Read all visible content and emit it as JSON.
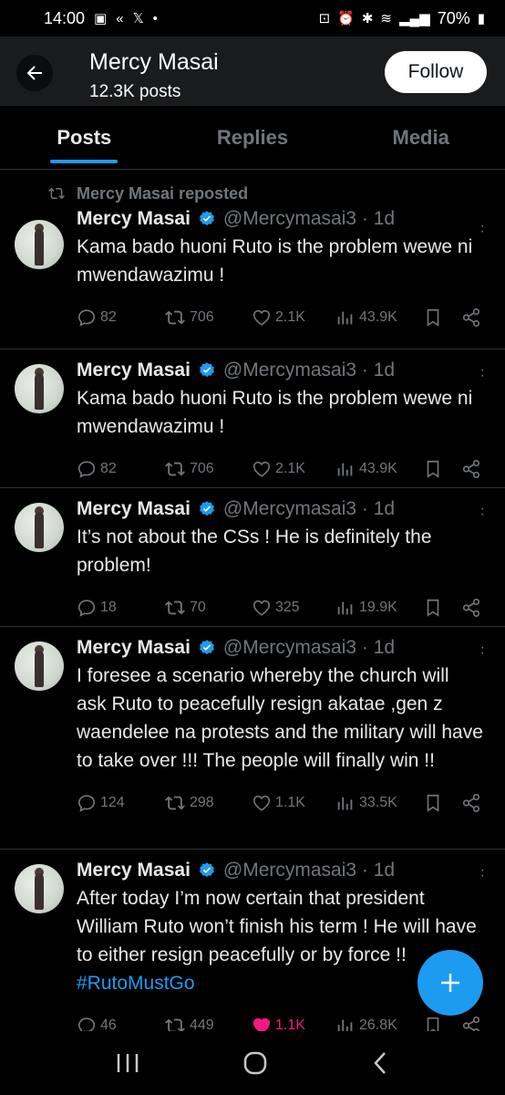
{
  "status_bar": {
    "time": "14:00",
    "battery": "70%"
  },
  "header": {
    "name": "Mercy Masai",
    "posts_count": "12.3K posts",
    "follow_label": "Follow"
  },
  "tabs": [
    {
      "label": "Posts",
      "active": true
    },
    {
      "label": "Replies",
      "active": false
    },
    {
      "label": "Media",
      "active": false
    }
  ],
  "tweets": [
    {
      "repost_label": "Mercy Masai reposted",
      "name": "Mercy Masai",
      "handle": "@Mercymasai3 · 1d",
      "text": "Kama bado huoni Ruto is the problem wewe ni mwendawazimu !",
      "replies": "82",
      "reposts": "706",
      "likes": "2.1K",
      "views": "43.9K",
      "liked": false
    },
    {
      "name": "Mercy Masai",
      "handle": "@Mercymasai3 · 1d",
      "text": "Kama bado huoni Ruto is the problem wewe ni mwendawazimu !",
      "replies": "82",
      "reposts": "706",
      "likes": "2.1K",
      "views": "43.9K",
      "liked": false
    },
    {
      "name": "Mercy Masai",
      "handle": "@Mercymasai3 · 1d",
      "text": "It’s not about the CSs ! He is definitely the problem!",
      "replies": "18",
      "reposts": "70",
      "likes": "325",
      "views": "19.9K",
      "liked": false
    },
    {
      "name": "Mercy Masai",
      "handle": "@Mercymasai3 · 1d",
      "text": "I foresee a scenario whereby the church will ask Ruto to peacefully resign akatae ,gen z waendelee na protests and the military will have to take over !!! The people will finally win !!",
      "replies": "124",
      "reposts": "298",
      "likes": "1.1K",
      "views": "33.5K",
      "liked": false
    },
    {
      "name": "Mercy Masai",
      "handle": "@Mercymasai3 · 1d",
      "text": "After today I’m now certain that president William Ruto  won’t finish his term ! He will have to either resign peacefully or by force !! ",
      "hashtag": "#RutoMustGo",
      "replies": "46",
      "reposts": "449",
      "likes": "1.1K",
      "views": "26.8K",
      "liked": true
    }
  ],
  "colors": {
    "accent": "#1d9bf0",
    "like": "#f91880",
    "muted": "#71767b",
    "background": "#000000"
  },
  "icons": [
    "back-arrow-icon",
    "verified-badge-icon",
    "reply-icon",
    "repost-icon",
    "like-icon",
    "views-icon",
    "bookmark-icon",
    "share-icon",
    "more-icon",
    "compose-plus-icon"
  ]
}
